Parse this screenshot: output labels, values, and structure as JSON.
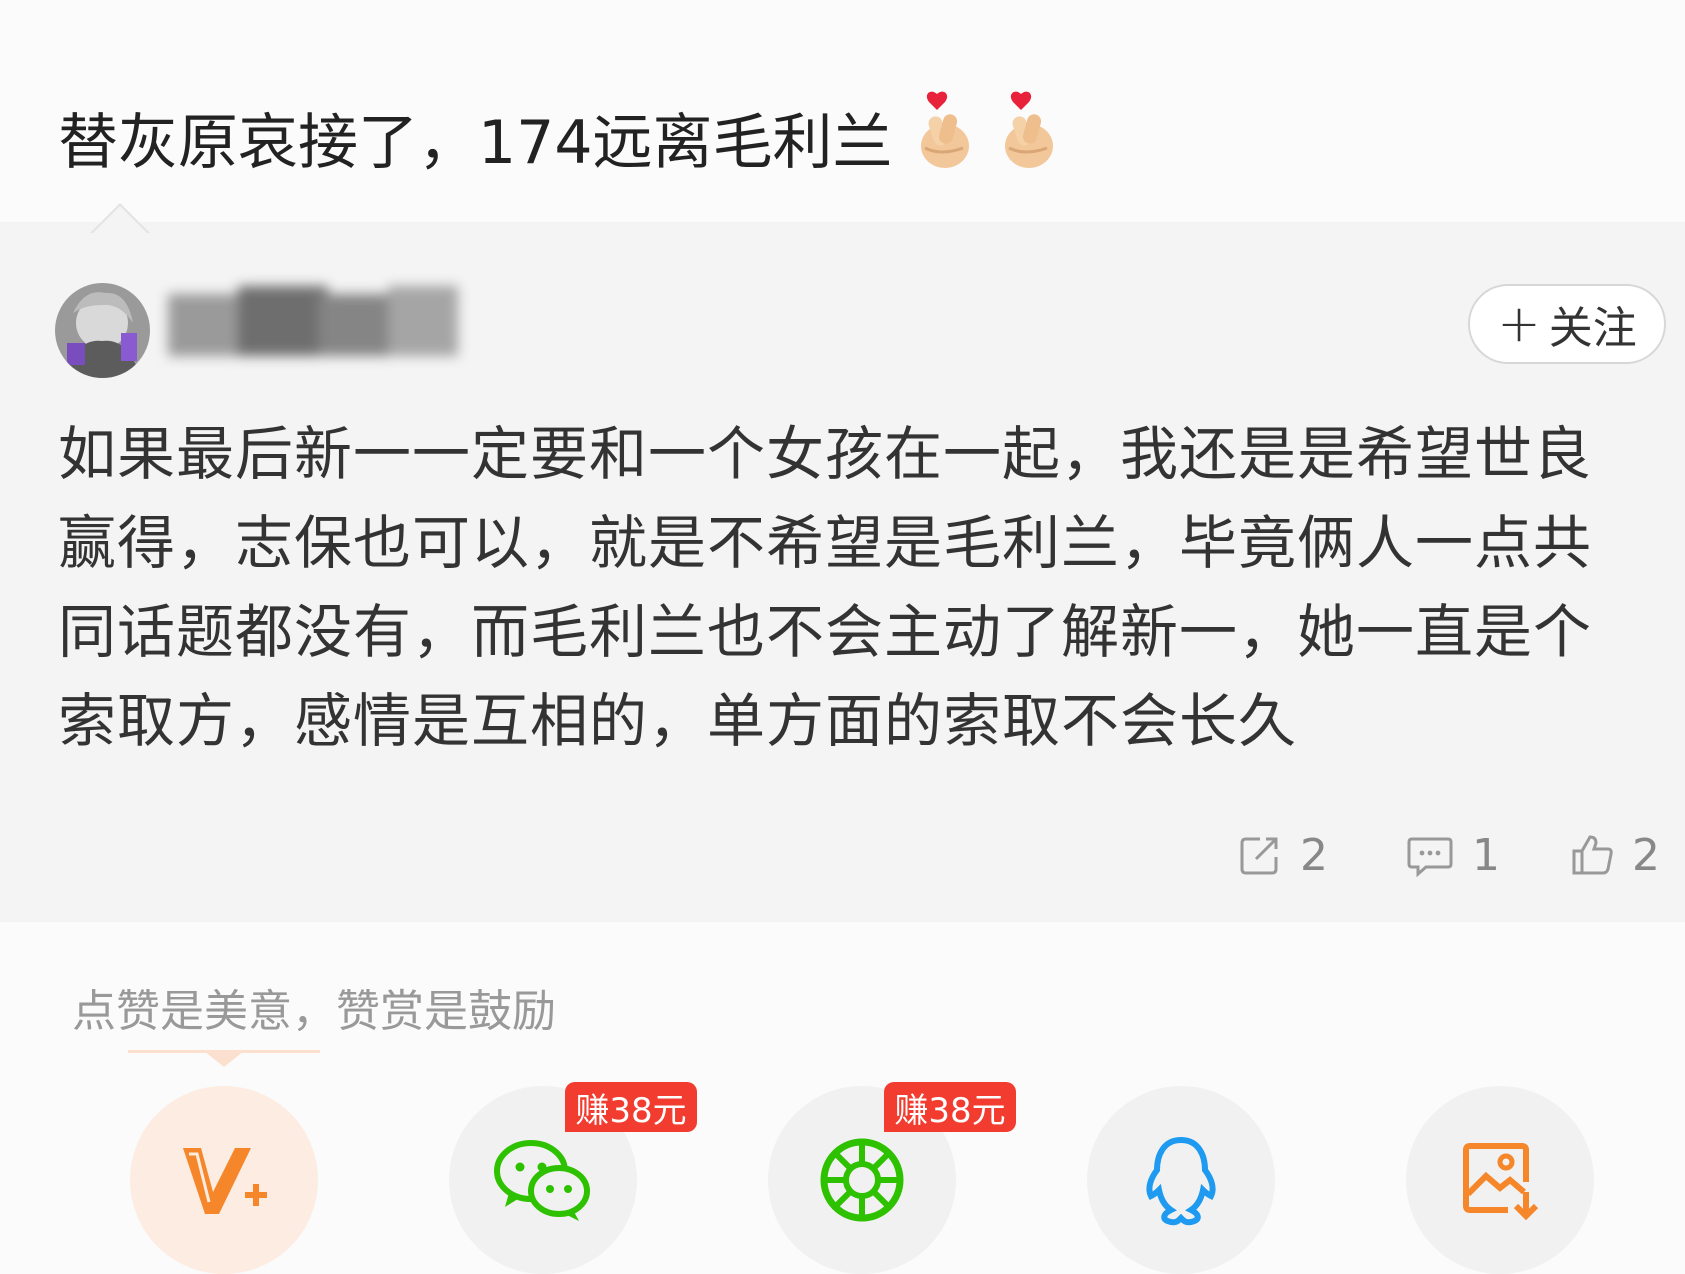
{
  "post": {
    "title": "替灰原哀接了，174远离毛利兰",
    "emoji": [
      "finger-heart-icon",
      "finger-heart-icon"
    ]
  },
  "quote": {
    "username": "青▇▇▇▇",
    "follow_label": "关注",
    "comment_text": "如果最后新一一定要和一个女孩在一起，我还是是希望世良赢得，志保也可以，就是不希望是毛利兰，毕竟俩人一点共同话题都没有，而毛利兰也不会主动了解新一，她一直是个索取方，感情是互相的，单方面的索取不会长久",
    "stats": {
      "shares": "2",
      "comments": "1",
      "likes": "2"
    }
  },
  "reward": {
    "text": "点赞是美意，赞赏是鼓励"
  },
  "share_targets": [
    {
      "icon": "v-plus-icon",
      "badge": ""
    },
    {
      "icon": "wechat-icon",
      "badge": "赚38元"
    },
    {
      "icon": "moments-icon",
      "badge": "赚38元"
    },
    {
      "icon": "qq-icon",
      "badge": ""
    },
    {
      "icon": "save-image-icon",
      "badge": ""
    }
  ],
  "colors": {
    "accent_orange": "#f5862a",
    "wechat_green": "#2dc100",
    "qq_blue": "#1e9bf0",
    "badge_red": "#f23c2f"
  }
}
